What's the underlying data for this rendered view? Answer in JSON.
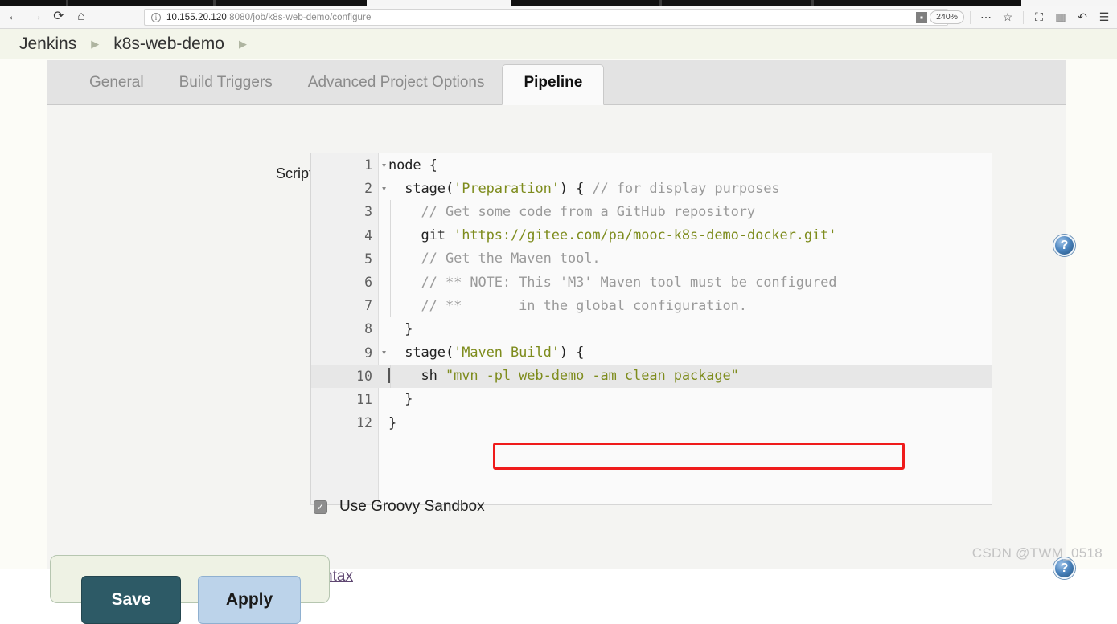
{
  "browser": {
    "nav": {
      "back": "←",
      "forward": "→",
      "reload": "⟳",
      "home": "⌂"
    },
    "url": {
      "host": "10.155.20.120",
      "rest": ":8080/job/k8s-web-demo/configure",
      "full": "10.155.20.120:8080/job/k8s-web-demo/configure"
    },
    "toolbar_right": {
      "zoom_level": "240%",
      "overflow": "⋯",
      "bookmark": "☆",
      "screenshot": "⛶",
      "reader": "▥",
      "undo": "↶",
      "menu": "☰"
    }
  },
  "breadcrumb": {
    "items": [
      {
        "label": "Jenkins"
      },
      {
        "label": "k8s-web-demo"
      }
    ],
    "separator": "▶"
  },
  "tabs": [
    {
      "label": "General",
      "active": false
    },
    {
      "label": "Build Triggers",
      "active": false
    },
    {
      "label": "Advanced Project Options",
      "active": false
    },
    {
      "label": "Pipeline",
      "active": true
    }
  ],
  "script": {
    "label": "Script",
    "help_glyph": "?",
    "lines": [
      {
        "num": "1",
        "fold": true,
        "guide": false,
        "highlight": false
      },
      {
        "num": "2",
        "fold": true,
        "guide": false,
        "highlight": false
      },
      {
        "num": "3",
        "fold": false,
        "guide": true,
        "highlight": false
      },
      {
        "num": "4",
        "fold": false,
        "guide": true,
        "highlight": false
      },
      {
        "num": "5",
        "fold": false,
        "guide": true,
        "highlight": false
      },
      {
        "num": "6",
        "fold": false,
        "guide": true,
        "highlight": false
      },
      {
        "num": "7",
        "fold": false,
        "guide": true,
        "highlight": false
      },
      {
        "num": "8",
        "fold": false,
        "guide": false,
        "highlight": false
      },
      {
        "num": "9",
        "fold": true,
        "guide": false,
        "highlight": false
      },
      {
        "num": "10",
        "fold": false,
        "guide": true,
        "highlight": true
      },
      {
        "num": "11",
        "fold": false,
        "guide": false,
        "highlight": false
      },
      {
        "num": "12",
        "fold": false,
        "guide": false,
        "highlight": false
      }
    ],
    "code": {
      "l1": "node {",
      "l2a": "  stage(",
      "l2b": "'Preparation'",
      "l2c": ") { ",
      "l2d": "// for display purposes",
      "l3": "    // Get some code from a GitHub repository",
      "l4a": "    git ",
      "l4b": "'https://gitee.com/pa/mooc-k8s-demo-docker.git'",
      "l5": "    // Get the Maven tool.",
      "l6": "    // ** NOTE: This 'M3' Maven tool must be configured",
      "l7": "    // **       in the global configuration.",
      "l8": "  }",
      "l9a": "  stage(",
      "l9b": "'Maven Build'",
      "l9c": ") {",
      "l10a": "    sh ",
      "l10b": "\"mvn -pl web-demo -am clean package\"",
      "l11": "  }",
      "l12": "}"
    },
    "annotation_color": "#ef1b1b"
  },
  "sandbox": {
    "label": "Use Groovy Sandbox",
    "checked": true,
    "check_glyph": "✓",
    "help_glyph": "?"
  },
  "pipeline_syntax_link": "Pipeline Syntax",
  "submit": {
    "save_label": "Save",
    "apply_label": "Apply"
  },
  "watermark": "CSDN @TWM_0518"
}
